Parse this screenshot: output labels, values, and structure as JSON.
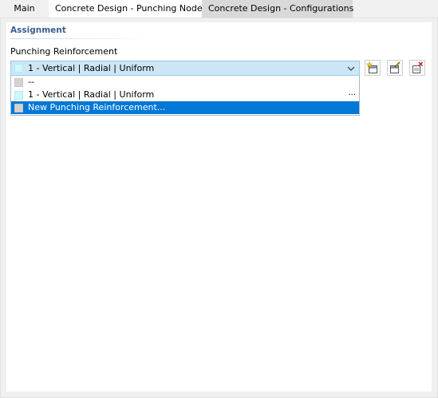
{
  "tabs": [
    {
      "label": "Main"
    },
    {
      "label": "Concrete Design - Punching Node"
    },
    {
      "label": "Concrete Design - Configurations"
    }
  ],
  "assignment": {
    "section_title": "Assignment",
    "field_label": "Punching Reinforcement",
    "selected_value": "1 - Vertical | Radial | Uniform",
    "options": [
      {
        "label": "--",
        "swatch_color": "#d3d3d3"
      },
      {
        "label": "1 - Vertical | Radial | Uniform",
        "swatch_color": "#cff7f9",
        "extra": "..."
      },
      {
        "label": "New Punching Reinforcement...",
        "swatch_color": "#d3d3d3",
        "highlighted": true
      }
    ]
  },
  "toolbar": {
    "icons": [
      "new-item-icon",
      "edit-item-icon",
      "delete-item-icon"
    ]
  },
  "colors": {
    "section_title": "#3a5f8f",
    "combo_background": "#cde6f7",
    "highlight": "#0078d7"
  }
}
